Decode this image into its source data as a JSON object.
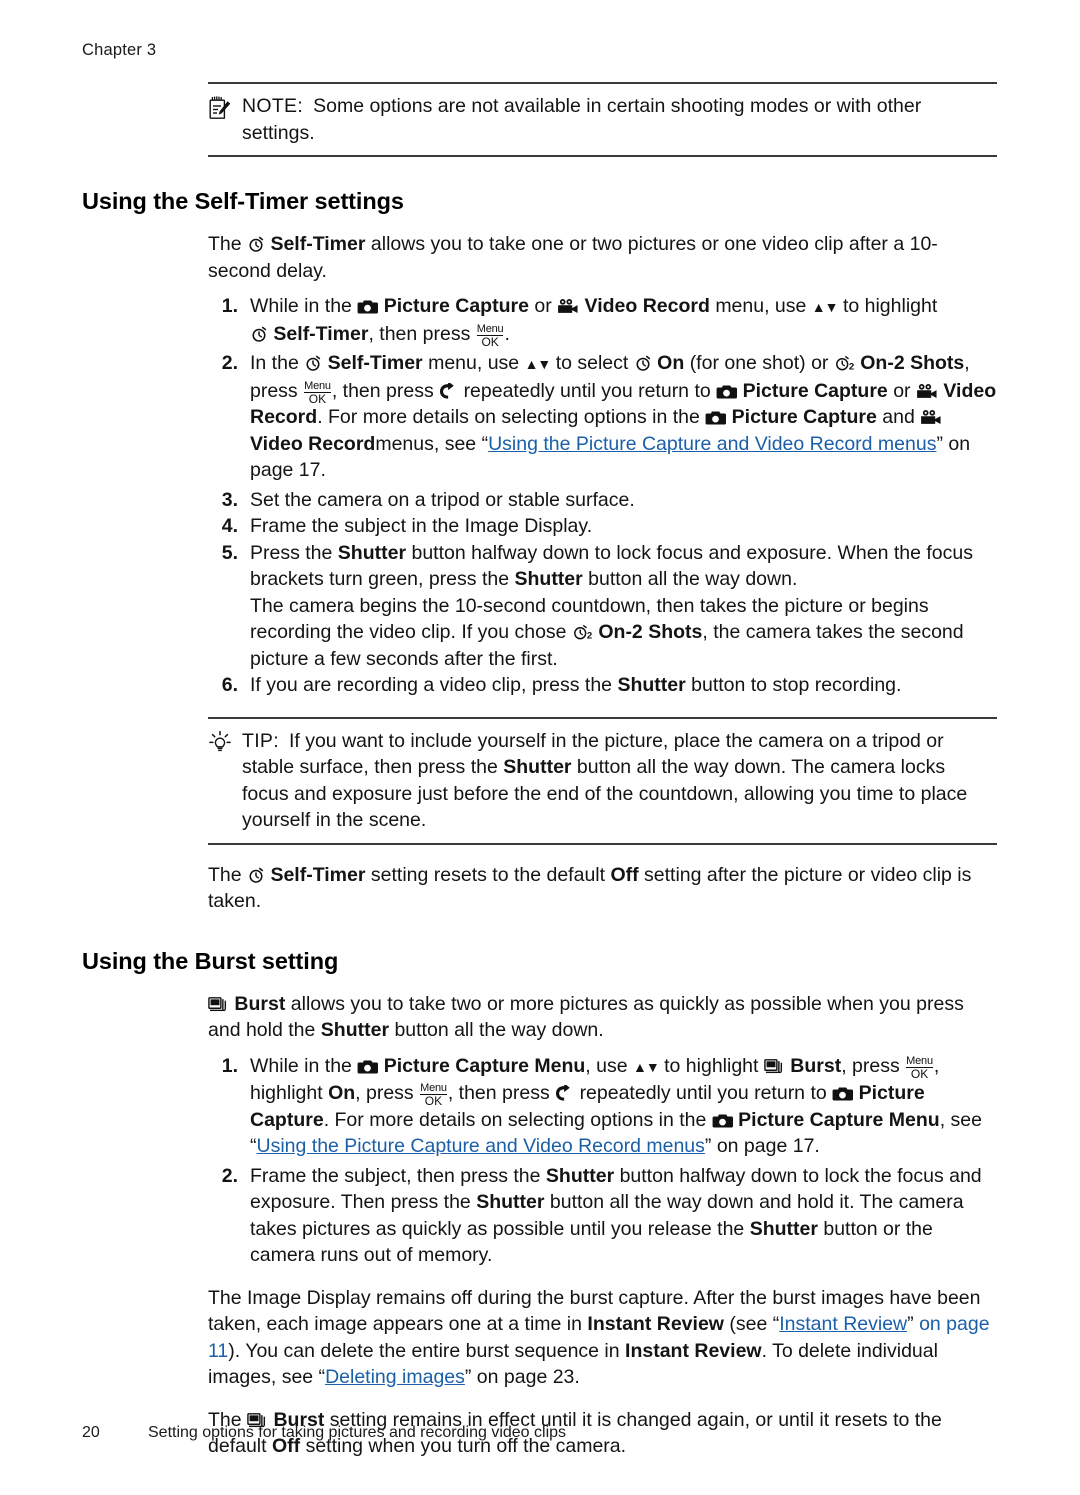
{
  "header": {
    "chapter": "Chapter 3"
  },
  "note": {
    "icon": "note-pad-pencil-icon",
    "label": "NOTE:",
    "text": "Some options are not available in certain shooting modes or with other settings."
  },
  "selftimer": {
    "heading": "Using the Self-Timer settings",
    "intro_a": "The",
    "intro_b": "Self-Timer",
    "intro_c": "allows you to take one or two pictures or one video clip after a 10-second delay.",
    "steps": [
      {
        "num": "1.",
        "parts": {
          "t1": "While in the",
          "b1": "Picture Capture",
          "t2": "or",
          "b2": "Video Record",
          "t3": "menu, use",
          "arrows": "▲▼",
          "t4": "to highlight",
          "b3": "Self-Timer",
          "t5": ", then press",
          "t6": "."
        }
      },
      {
        "num": "2.",
        "parts": {
          "t1": "In the",
          "b1": "Self-Timer",
          "t2": "menu, use",
          "arrows": "▲▼",
          "t3": "to select",
          "b2": "On",
          "t4": "(for one shot) or",
          "b3": "On-2 Shots",
          "t5": ", press",
          "t6": ", then press",
          "t7": "repeatedly until you return to",
          "b4": "Picture Capture",
          "t8": "or",
          "b5": "Video Record",
          "t9": ". For more details on selecting options in the",
          "b6": "Picture Capture",
          "t10": "and",
          "b7": "Video Record",
          "t11": "menus, see “",
          "link": "Using the Picture Capture and Video Record menus",
          "t12": "” on page 17."
        }
      },
      {
        "num": "3.",
        "text": "Set the camera on a tripod or stable surface."
      },
      {
        "num": "4.",
        "text": "Frame the subject in the Image Display."
      },
      {
        "num": "5.",
        "parts": {
          "t1": "Press the",
          "b1": "Shutter",
          "t2": "button halfway down to lock focus and exposure. When the focus brackets turn green, press the",
          "b2": "Shutter",
          "t3": "button all the way down.",
          "t4": "The camera begins the 10-second countdown, then takes the picture or begins recording the video clip. If you chose",
          "b3": "On-2 Shots",
          "t5": ", the camera takes the second picture a few seconds after the first."
        }
      },
      {
        "num": "6.",
        "parts": {
          "t1": "If you are recording a video clip, press the",
          "b1": "Shutter",
          "t2": "button to stop recording."
        }
      }
    ],
    "tip": {
      "icon": "lightbulb-icon",
      "label": "TIP:",
      "t1": "If you want to include yourself in the picture, place the camera on a tripod or stable surface, then press the",
      "b1": "Shutter",
      "t2": "button all the way down. The camera locks focus and exposure just before the end of the countdown, allowing you time to place yourself in the scene."
    },
    "closing": {
      "t1": "The",
      "b1": "Self-Timer",
      "t2": "setting resets to the default",
      "b2": "Off",
      "t3": "setting after the picture or video clip is taken."
    }
  },
  "burst": {
    "heading": "Using the Burst setting",
    "intro": {
      "b1": "Burst",
      "t1": "allows you to take two or more pictures as quickly as possible when you press and hold the",
      "b2": "Shutter",
      "t2": "button all the way down."
    },
    "steps": [
      {
        "num": "1.",
        "parts": {
          "t1": "While in the",
          "b1": "Picture Capture Menu",
          "t2": ", use",
          "arrows": "▲▼",
          "t3": "to highlight",
          "b2": "Burst",
          "t4": ", press",
          "t5": ", highlight",
          "b3": "On",
          "t6": ", press",
          "t7": ", then press",
          "t8": "repeatedly until you return to",
          "b4": "Picture Capture",
          "t9": ". For more details on selecting options in the",
          "b5": "Picture Capture Menu",
          "t10": ", see “",
          "link": "Using the Picture Capture and Video Record menus",
          "t11": "” on page 17."
        }
      },
      {
        "num": "2.",
        "parts": {
          "t1": "Frame the subject, then press the",
          "b1": "Shutter",
          "t2": "button halfway down to lock the focus and exposure. Then press the",
          "b2": "Shutter",
          "t3": "button all the way down and hold it. The camera takes pictures as quickly as possible until you release the",
          "b3": "Shutter",
          "t4": "button or the camera runs out of memory."
        }
      }
    ],
    "review_para": {
      "t1": "The Image Display remains off during the burst capture. After the burst images have been taken, each image appears one at a time in",
      "b1": "Instant Review",
      "t2": "(see “",
      "link1": "Instant Review",
      "t3": "” ",
      "link2": "on page 11",
      "t4": "). You can delete the entire burst sequence in",
      "b2": "Instant Review",
      "t5": ". To delete individual images, see “",
      "link3": "Deleting images",
      "t6": "” on page 23."
    },
    "closing": {
      "t1": "The",
      "b1": "Burst",
      "t2": "setting remains in effect until it is changed again, or until it resets to the default",
      "b2": "Off",
      "t3": "setting when you turn off the camera."
    }
  },
  "footer": {
    "page_number": "20",
    "text": "Setting options for taking pictures and recording video clips"
  },
  "colors": {
    "link": "#1b5fa8",
    "text": "#141414",
    "rule": "#3a3a3a"
  }
}
